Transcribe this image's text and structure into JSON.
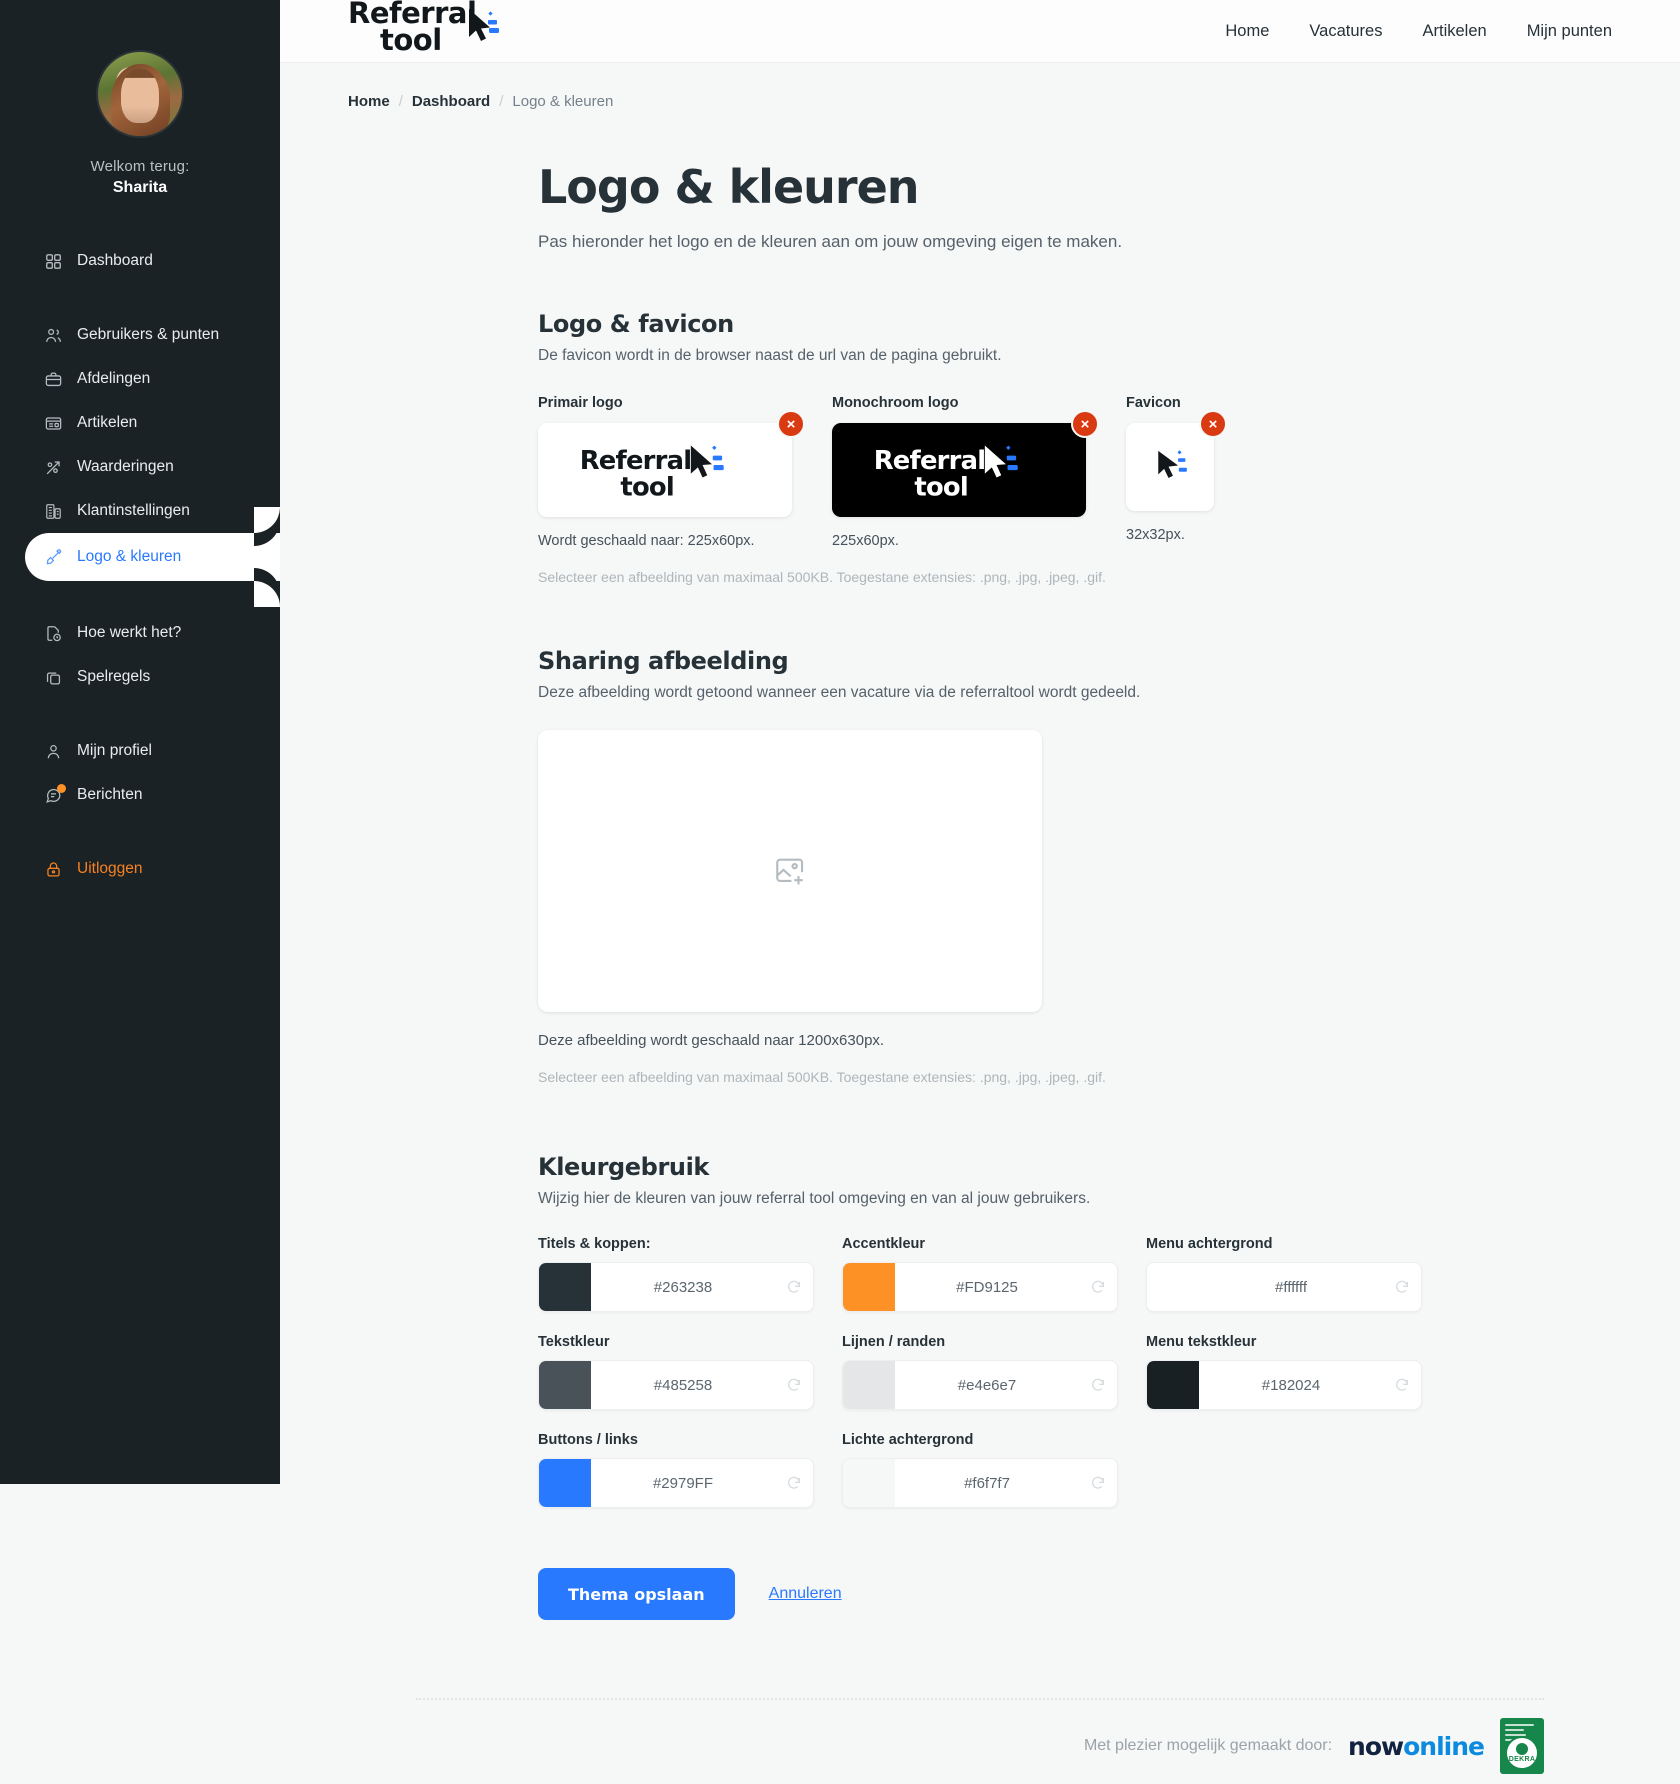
{
  "sidebar": {
    "welcome_label": "Welkom terug:",
    "user_name": "Sharita",
    "avatar_name": "avatar",
    "groups": [
      {
        "items": [
          {
            "label": "Dashboard",
            "icon": "grid-icon",
            "active": false
          }
        ]
      },
      {
        "items": [
          {
            "label": "Gebruikers & punten",
            "icon": "users-icon",
            "active": false
          },
          {
            "label": "Afdelingen",
            "icon": "briefcase-icon",
            "active": false
          },
          {
            "label": "Artikelen",
            "icon": "article-icon",
            "active": false
          },
          {
            "label": "Waarderingen",
            "icon": "chart-arrow-icon",
            "active": false
          },
          {
            "label": "Klantinstellingen",
            "icon": "building-icon",
            "active": false
          },
          {
            "label": "Logo & kleuren",
            "icon": "brush-icon",
            "active": true
          }
        ]
      },
      {
        "items": [
          {
            "label": "Hoe werkt het?",
            "icon": "document-question-icon",
            "active": false
          },
          {
            "label": "Spelregels",
            "icon": "cards-icon",
            "active": false
          }
        ]
      },
      {
        "items": [
          {
            "label": "Mijn profiel",
            "icon": "person-icon",
            "active": false
          },
          {
            "label": "Berichten",
            "icon": "message-icon",
            "active": false,
            "badge": true
          }
        ]
      },
      {
        "items": [
          {
            "label": "Uitloggen",
            "icon": "lock-icon",
            "active": false,
            "logout": true
          }
        ]
      }
    ]
  },
  "header": {
    "brand_line1": "Referral",
    "brand_line2": "tool",
    "nav": [
      {
        "label": "Home"
      },
      {
        "label": "Vacatures"
      },
      {
        "label": "Artikelen"
      },
      {
        "label": "Mijn punten"
      }
    ]
  },
  "breadcrumb": {
    "home": "Home",
    "dashboard": "Dashboard",
    "current": "Logo & kleuren",
    "separator": "/"
  },
  "page": {
    "title": "Logo & kleuren",
    "subtitle": "Pas hieronder het logo en de kleuren aan om jouw omgeving eigen te maken."
  },
  "logo_section": {
    "title": "Logo & favicon",
    "subtitle": "De favicon wordt in de browser naast de url van de pagina gebruikt.",
    "uploads": [
      {
        "label": "Primair logo",
        "note": "Wordt geschaald naar: 225x60px.",
        "kind": "primary",
        "remove_label": "×"
      },
      {
        "label": "Monochroom logo",
        "note": "225x60px.",
        "kind": "mono",
        "remove_label": "×"
      },
      {
        "label": "Favicon",
        "note": "32x32px.",
        "kind": "fav",
        "remove_label": "×"
      }
    ],
    "hint": "Selecteer een afbeelding van maximaal 500KB. Toegestane extensies: .png, .jpg, .jpeg, .gif."
  },
  "sharing_section": {
    "title": "Sharing afbeelding",
    "subtitle": "Deze afbeelding wordt getoond wanneer een vacature via de referraltool wordt gedeeld.",
    "placeholder_icon": "image-add-icon",
    "note": "Deze afbeelding wordt geschaald naar 1200x630px.",
    "hint": "Selecteer een afbeelding van maximaal 500KB. Toegestane extensies: .png, .jpg, .jpeg, .gif."
  },
  "colors_section": {
    "title": "Kleurgebruik",
    "subtitle": "Wijzig hier de kleuren van jouw referral tool omgeving en van al jouw gebruikers.",
    "fields": [
      {
        "label": "Titels & koppen:",
        "value": "#263238",
        "swatch": "#263238"
      },
      {
        "label": "Accentkleur",
        "value": "#FD9125",
        "swatch": "#FD9125"
      },
      {
        "label": "Menu achtergrond",
        "value": "#ffffff",
        "swatch": "#ffffff"
      },
      {
        "label": "Tekstkleur",
        "value": "#485258",
        "swatch": "#485258"
      },
      {
        "label": "Lijnen / randen",
        "value": "#e4e6e7",
        "swatch": "#e4e6e7"
      },
      {
        "label": "Menu tekstkleur",
        "value": "#182024",
        "swatch": "#182024"
      },
      {
        "label": "Buttons / links",
        "value": "#2979FF",
        "swatch": "#2979FF"
      },
      {
        "label": "Lichte achtergrond",
        "value": "#f6f7f7",
        "swatch": "#f6f7f7"
      }
    ],
    "reset_icon": "reset-icon"
  },
  "actions": {
    "save_label": "Thema opslaan",
    "cancel_label": "Annuleren"
  },
  "footer": {
    "text": "Met plezier mogelijk gemaakt door:",
    "logo_now": "now",
    "logo_online": "online",
    "certificate": "dekra-badge"
  }
}
